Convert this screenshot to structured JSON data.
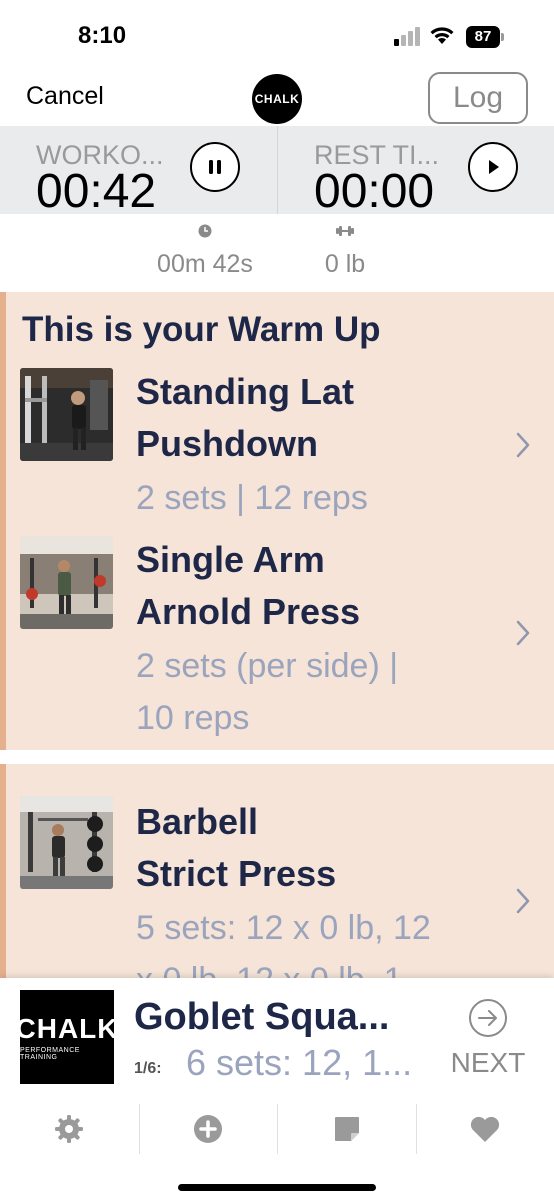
{
  "status_bar": {
    "time": "8:10",
    "battery": "87"
  },
  "nav": {
    "cancel_label": "Cancel",
    "logo_text": "CHALK",
    "log_label": "Log"
  },
  "timers": {
    "workout": {
      "label": "WORKO...",
      "value": "00:42",
      "control": "pause"
    },
    "rest": {
      "label": "REST TI...",
      "value": "00:00",
      "control": "play"
    }
  },
  "stats": {
    "duration": "00m 42s",
    "weight": "0 lb"
  },
  "section": {
    "title": "This is your Warm Up",
    "exercises": [
      {
        "name_line1": "Standing Lat",
        "name_line2": "Pushdown",
        "detail_line1": "2 sets | 12 reps",
        "detail_line2": ""
      },
      {
        "name_line1": "Single Arm",
        "name_line2": "Arnold Press",
        "detail_line1": "2 sets (per side) |",
        "detail_line2": "10 reps"
      }
    ]
  },
  "section2": {
    "exercises": [
      {
        "name_line1": "Barbell",
        "name_line2": "Strict Press",
        "detail_line1": "5 sets: 12 x 0 lb, 12",
        "detail_line2": "x 0 lb, 12 x 0 lb, 1"
      }
    ]
  },
  "up_next": {
    "logo_text": "CHALK",
    "logo_subtext": "PERFORMANCE TRAINING",
    "title": "Goblet Squa...",
    "count": "1/6:",
    "detail": "6 sets: 12, 1...",
    "next_label": "NEXT"
  },
  "tab_bar": {
    "tabs": [
      "settings-icon",
      "add-icon",
      "note-icon",
      "heart-icon"
    ]
  },
  "colors": {
    "card_bg": "#f5e4d7",
    "card_accent": "#e5b08d",
    "title_navy": "#1e2747",
    "detail_blue_gray": "#9ba4bd"
  }
}
